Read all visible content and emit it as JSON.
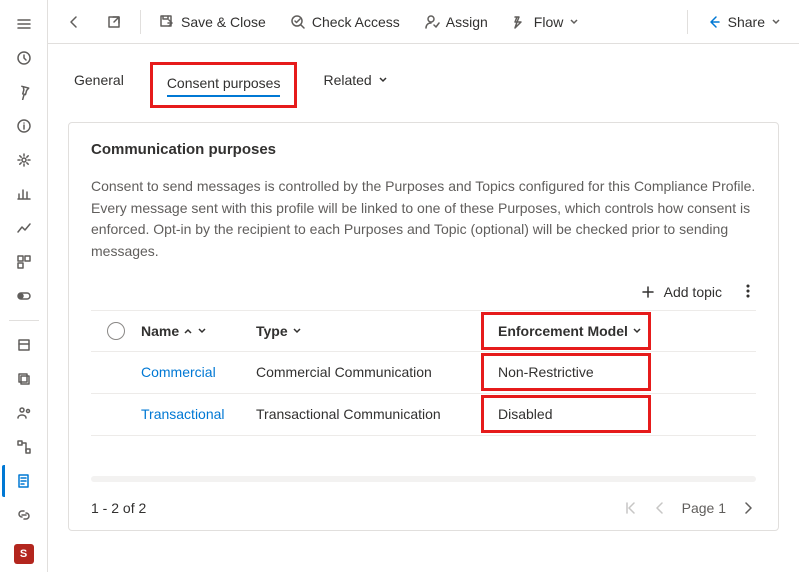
{
  "toolbar": {
    "save_close": "Save & Close",
    "check_access": "Check Access",
    "assign": "Assign",
    "flow": "Flow",
    "share": "Share"
  },
  "tabs": {
    "general": "General",
    "consent": "Consent purposes",
    "related": "Related"
  },
  "card": {
    "title": "Communication purposes",
    "desc": "Consent to send messages is controlled by the Purposes and Topics configured for this Compliance Profile. Every message sent with this profile will be linked to one of these Purposes, which controls how consent is enforced. Opt-in by the recipient to each Purposes and Topic (optional) will be checked prior to sending messages.",
    "add_topic": "Add topic"
  },
  "grid": {
    "cols": {
      "name": "Name",
      "type": "Type",
      "enf": "Enforcement Model"
    },
    "rows": [
      {
        "name": "Commercial",
        "type": "Commercial Communication",
        "enf": "Non-Restrictive"
      },
      {
        "name": "Transactional",
        "type": "Transactional Communication",
        "enf": "Disabled"
      }
    ]
  },
  "pager": {
    "range": "1 - 2 of 2",
    "page": "Page 1"
  },
  "badge": "S"
}
